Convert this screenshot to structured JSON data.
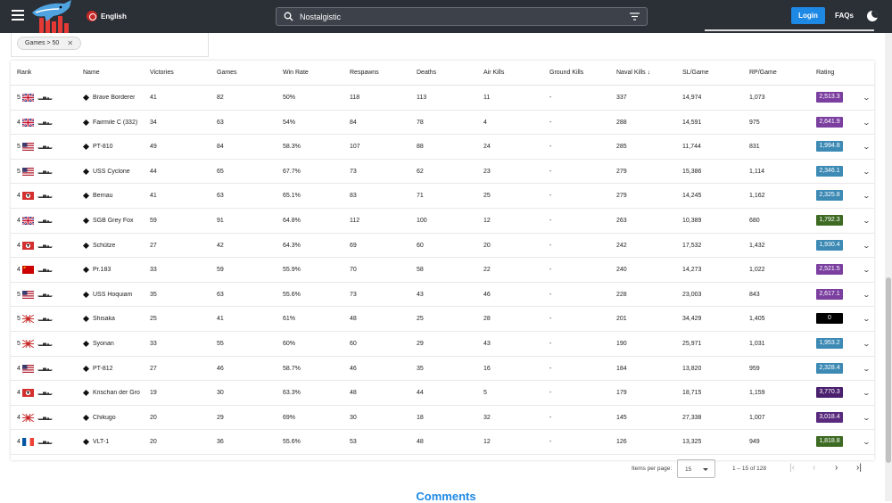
{
  "header": {
    "language": "English",
    "search_value": "Nostalgistic",
    "login_label": "Login",
    "faqs_label": "FAQs"
  },
  "filters": {
    "chip_label": "Games > 50"
  },
  "table": {
    "columns": {
      "rank": "Rank",
      "name": "Name",
      "victories": "Victories",
      "games": "Games",
      "win_rate": "Win Rate",
      "respawns": "Respawns",
      "deaths": "Deaths",
      "air_kills": "Air Kills",
      "ground_kills": "Ground Kills",
      "naval_kills": "Naval Kills",
      "sl_game": "SL/Game",
      "rp_game": "RP/Game",
      "rating": "Rating"
    },
    "rows": [
      {
        "tier": "5",
        "nation": "uk",
        "name": "Brave Borderer",
        "victories": "41",
        "games": "82",
        "win_rate": "50%",
        "respawns": "118",
        "deaths": "113",
        "air_kills": "11",
        "ground_kills": "-",
        "naval_kills": "337",
        "sl_game": "14,974",
        "rp_game": "1,073",
        "rating": "2,513.3",
        "rating_color": "#7b3fa0"
      },
      {
        "tier": "4",
        "nation": "uk",
        "name": "Fairmile C (332)",
        "victories": "34",
        "games": "63",
        "win_rate": "54%",
        "respawns": "84",
        "deaths": "78",
        "air_kills": "4",
        "ground_kills": "-",
        "naval_kills": "288",
        "sl_game": "14,591",
        "rp_game": "975",
        "rating": "2,641.9",
        "rating_color": "#7b3fa0"
      },
      {
        "tier": "5",
        "nation": "us",
        "name": "PT-810",
        "victories": "49",
        "games": "84",
        "win_rate": "58.3%",
        "respawns": "107",
        "deaths": "88",
        "air_kills": "24",
        "ground_kills": "-",
        "naval_kills": "285",
        "sl_game": "11,744",
        "rp_game": "831",
        "rating": "1,994.8",
        "rating_color": "#3d8ab5"
      },
      {
        "tier": "5",
        "nation": "us",
        "name": "USS Cyclone",
        "victories": "44",
        "games": "65",
        "win_rate": "67.7%",
        "respawns": "73",
        "deaths": "62",
        "air_kills": "23",
        "ground_kills": "-",
        "naval_kills": "279",
        "sl_game": "15,386",
        "rp_game": "1,114",
        "rating": "2,346.1",
        "rating_color": "#3d8ab5"
      },
      {
        "tier": "4",
        "nation": "de",
        "name": "Bernau",
        "victories": "41",
        "games": "63",
        "win_rate": "65.1%",
        "respawns": "83",
        "deaths": "71",
        "air_kills": "25",
        "ground_kills": "-",
        "naval_kills": "279",
        "sl_game": "14,245",
        "rp_game": "1,162",
        "rating": "2,325.8",
        "rating_color": "#3d8ab5"
      },
      {
        "tier": "4",
        "nation": "uk",
        "name": "SGB Grey Fox",
        "victories": "59",
        "games": "91",
        "win_rate": "64.8%",
        "respawns": "112",
        "deaths": "100",
        "air_kills": "12",
        "ground_kills": "-",
        "naval_kills": "263",
        "sl_game": "10,389",
        "rp_game": "680",
        "rating": "1,792.3",
        "rating_color": "#3e6b23"
      },
      {
        "tier": "4",
        "nation": "de",
        "name": "Schütze",
        "victories": "27",
        "games": "42",
        "win_rate": "64.3%",
        "respawns": "69",
        "deaths": "60",
        "air_kills": "20",
        "ground_kills": "-",
        "naval_kills": "242",
        "sl_game": "17,532",
        "rp_game": "1,432",
        "rating": "1,930.4",
        "rating_color": "#3d8ab5"
      },
      {
        "tier": "4",
        "nation": "ussr",
        "name": "Pr.183",
        "victories": "33",
        "games": "59",
        "win_rate": "55.9%",
        "respawns": "70",
        "deaths": "58",
        "air_kills": "22",
        "ground_kills": "-",
        "naval_kills": "240",
        "sl_game": "14,273",
        "rp_game": "1,022",
        "rating": "2,521.5",
        "rating_color": "#7b3fa0"
      },
      {
        "tier": "5",
        "nation": "us",
        "name": "USS Hoquiam",
        "victories": "35",
        "games": "63",
        "win_rate": "55.6%",
        "respawns": "73",
        "deaths": "43",
        "air_kills": "46",
        "ground_kills": "-",
        "naval_kills": "228",
        "sl_game": "23,003",
        "rp_game": "843",
        "rating": "2,617.1",
        "rating_color": "#7b3fa0"
      },
      {
        "tier": "5",
        "nation": "jp",
        "name": "Shisaka",
        "victories": "25",
        "games": "41",
        "win_rate": "61%",
        "respawns": "48",
        "deaths": "25",
        "air_kills": "28",
        "ground_kills": "-",
        "naval_kills": "201",
        "sl_game": "34,429",
        "rp_game": "1,405",
        "rating": "0",
        "rating_color": "#000000"
      },
      {
        "tier": "5",
        "nation": "jp",
        "name": "Syonan",
        "victories": "33",
        "games": "55",
        "win_rate": "60%",
        "respawns": "60",
        "deaths": "29",
        "air_kills": "43",
        "ground_kills": "-",
        "naval_kills": "190",
        "sl_game": "25,971",
        "rp_game": "1,031",
        "rating": "1,953.2",
        "rating_color": "#3d8ab5"
      },
      {
        "tier": "4",
        "nation": "us",
        "name": "PT-812",
        "victories": "27",
        "games": "46",
        "win_rate": "58.7%",
        "respawns": "46",
        "deaths": "35",
        "air_kills": "16",
        "ground_kills": "-",
        "naval_kills": "184",
        "sl_game": "13,820",
        "rp_game": "959",
        "rating": "2,328.4",
        "rating_color": "#3d8ab5"
      },
      {
        "tier": "4",
        "nation": "de",
        "name": "Krischan der Gro",
        "victories": "19",
        "games": "30",
        "win_rate": "63.3%",
        "respawns": "48",
        "deaths": "44",
        "air_kills": "5",
        "ground_kills": "-",
        "naval_kills": "179",
        "sl_game": "18,715",
        "rp_game": "1,159",
        "rating": "3,770.3",
        "rating_color": "#4a1f6e"
      },
      {
        "tier": "4",
        "nation": "jp",
        "name": "Chikugo",
        "victories": "20",
        "games": "29",
        "win_rate": "69%",
        "respawns": "30",
        "deaths": "18",
        "air_kills": "32",
        "ground_kills": "-",
        "naval_kills": "145",
        "sl_game": "27,338",
        "rp_game": "1,007",
        "rating": "3,018.4",
        "rating_color": "#5a2a7e"
      },
      {
        "tier": "4",
        "nation": "fr",
        "name": "VLT-1",
        "victories": "20",
        "games": "36",
        "win_rate": "55.6%",
        "respawns": "53",
        "deaths": "48",
        "air_kills": "12",
        "ground_kills": "-",
        "naval_kills": "126",
        "sl_game": "13,325",
        "rp_game": "949",
        "rating": "1,818.8",
        "rating_color": "#3e6b23"
      }
    ]
  },
  "pagination": {
    "items_per_page_label": "Items per page:",
    "items_per_page": "15",
    "range": "1 – 15 of 128"
  },
  "comments_heading": "Comments"
}
